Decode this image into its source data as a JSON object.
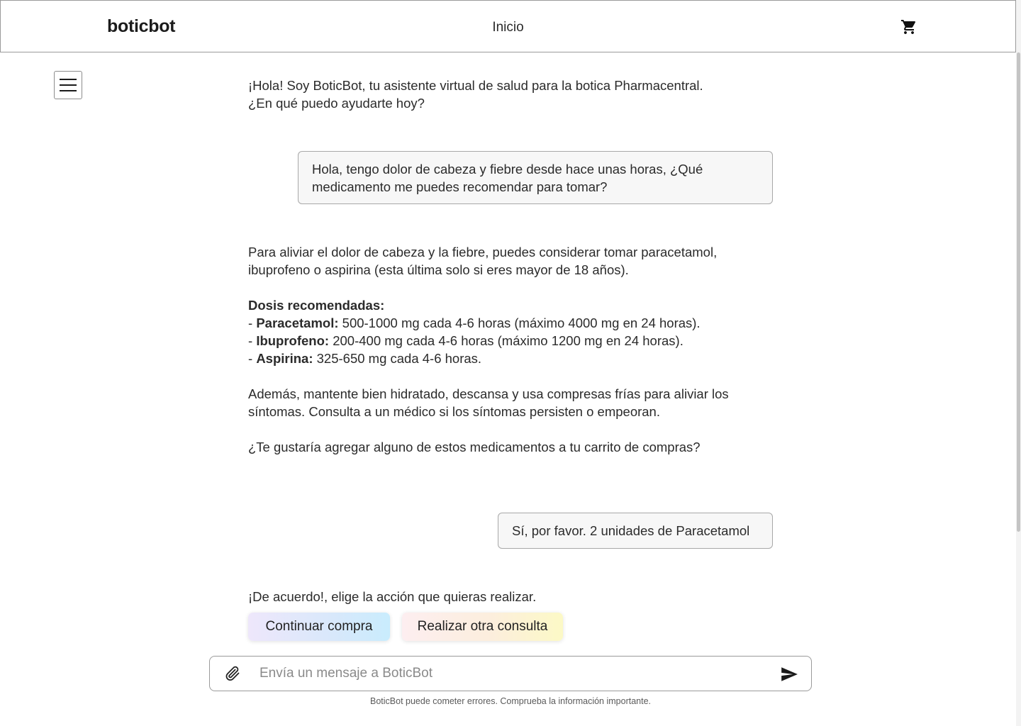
{
  "header": {
    "brand": "boticbot",
    "nav_home": "Inicio",
    "cart_icon": "cart-icon"
  },
  "sidebar": {
    "menu_icon": "hamburger-menu-icon"
  },
  "chat": {
    "greeting_line1": "¡Hola! Soy BoticBot, tu asistente virtual de salud para la botica Pharmacentral.",
    "greeting_line2": "¿En qué puedo ayudarte hoy?",
    "user_msg_1": "Hola, tengo dolor de cabeza y fiebre desde hace unas horas, ¿Qué medicamento me puedes recomendar para tomar?",
    "bot_reply": {
      "intro": "Para aliviar el dolor de cabeza y la fiebre, puedes considerar tomar paracetamol, ibuprofeno o aspirina (esta última solo si eres mayor de 18 años).",
      "dose_heading": "Dosis recomendadas:",
      "doses": [
        {
          "prefix": "- ",
          "name": "Paracetamol:",
          "text": " 500-1000 mg cada 4-6 horas (máximo 4000 mg en 24 horas)."
        },
        {
          "prefix": "- ",
          "name": "Ibuprofeno:",
          "text": " 200-400 mg cada 4-6 horas (máximo 1200 mg en 24 horas)."
        },
        {
          "prefix": "- ",
          "name": "Aspirina:",
          "text": " 325-650 mg cada 4-6 horas."
        }
      ],
      "advice": "Además, mantente bien hidratado, descansa y usa compresas frías para aliviar los síntomas. Consulta a un médico si los síntomas persisten o empeoran.",
      "question": "¿Te gustaría agregar alguno de estos medicamentos a tu carrito de compras?"
    },
    "user_msg_2": "Sí, por favor. 2 unidades de Paracetamol",
    "bot_confirm": "¡De acuerdo!, elige la acción que quieras realizar.",
    "actions": {
      "continue_label": "Continuar compra",
      "other_label": "Realizar otra consulta"
    }
  },
  "composer": {
    "placeholder": "Envía un mensaje a BoticBot",
    "value": "",
    "attach_icon": "paperclip-icon",
    "send_icon": "send-icon"
  },
  "disclaimer": "BoticBot puede cometer errores. Comprueba la información importante."
}
